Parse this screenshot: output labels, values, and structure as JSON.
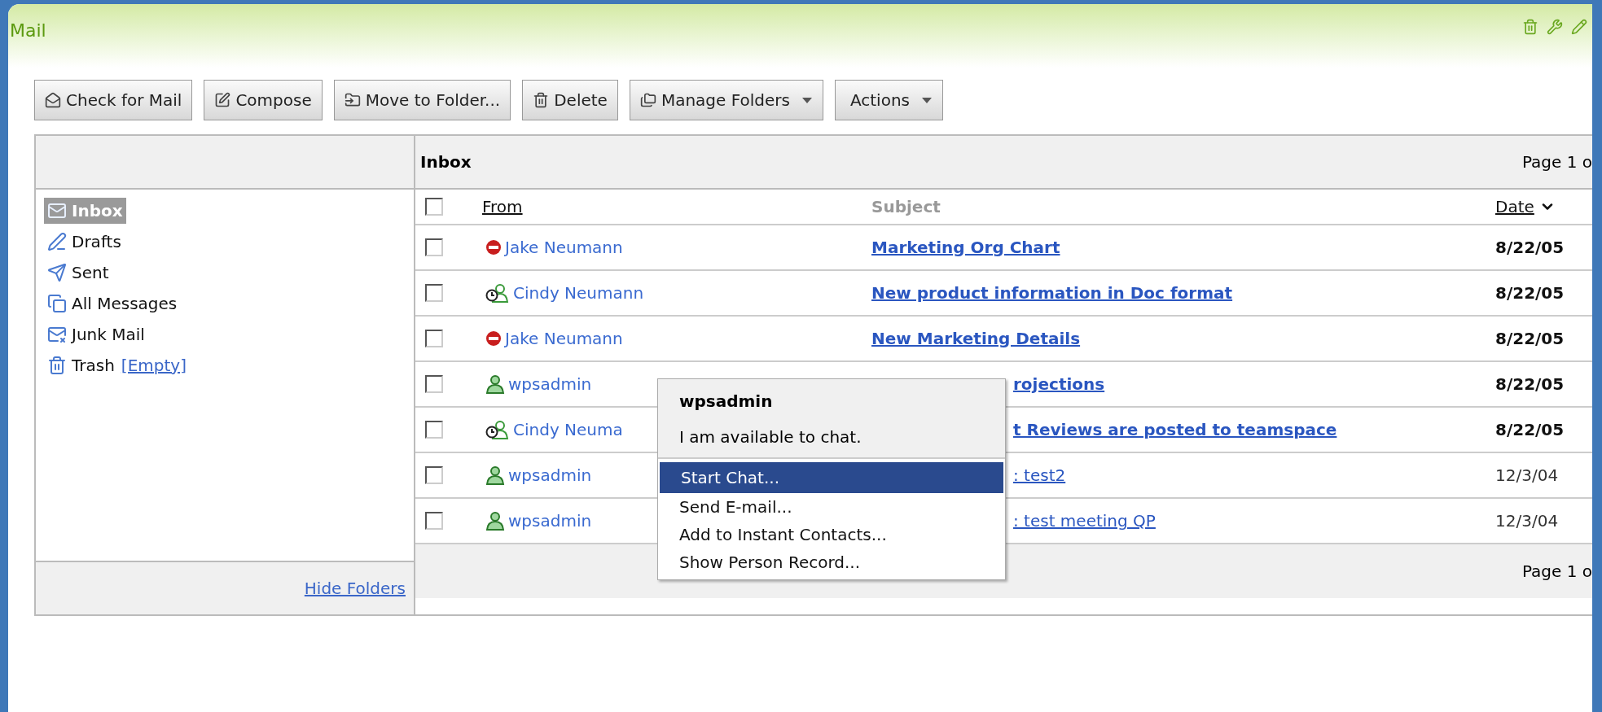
{
  "portlet": {
    "title": "Mail"
  },
  "toolbar": [
    {
      "label": "Check for Mail",
      "dropdown": false
    },
    {
      "label": "Compose",
      "dropdown": false
    },
    {
      "label": "Move to Folder...",
      "dropdown": false
    },
    {
      "label": "Delete",
      "dropdown": false
    },
    {
      "label": "Manage Folders",
      "dropdown": true
    },
    {
      "label": "Actions",
      "dropdown": true
    }
  ],
  "folders": {
    "items": [
      {
        "label": "Inbox",
        "selected": true
      },
      {
        "label": "Drafts",
        "selected": false
      },
      {
        "label": "Sent",
        "selected": false
      },
      {
        "label": "All Messages",
        "selected": false
      },
      {
        "label": "Junk Mail",
        "selected": false
      },
      {
        "label": "Trash",
        "selected": false,
        "link": "[Empty]"
      }
    ],
    "footer_link": "Hide Folders"
  },
  "inbox": {
    "title": "Inbox",
    "page_info": "Page 1 o",
    "select_all_checked": false,
    "columns": [
      {
        "label": "From",
        "sortable": true,
        "sorted": false
      },
      {
        "label": "Subject",
        "sortable": false,
        "sorted": false
      },
      {
        "label": "Date",
        "sortable": true,
        "sorted": true
      }
    ],
    "rows": [
      {
        "checked": false,
        "kind": "busy",
        "from": "Jake Neumann",
        "subject": "Marketing Org Chart",
        "covered": false,
        "date": "8/22/05",
        "unread": true
      },
      {
        "checked": false,
        "kind": "away",
        "from": "Cindy Neumann",
        "subject": "New product information in Doc format",
        "covered": false,
        "date": "8/22/05",
        "unread": true
      },
      {
        "checked": false,
        "kind": "busy",
        "from": "Jake Neumann",
        "subject": "New Marketing Details",
        "covered": false,
        "date": "8/22/05",
        "unread": true
      },
      {
        "checked": false,
        "kind": "available",
        "from": "wpsadmin",
        "subject": "rojections",
        "covered": true,
        "date": "8/22/05",
        "unread": true
      },
      {
        "checked": false,
        "kind": "away",
        "from": "Cindy Neuma",
        "subject": "t Reviews are posted to teamspace",
        "covered": true,
        "date": "8/22/05",
        "unread": true
      },
      {
        "checked": false,
        "kind": "available",
        "from": "wpsadmin",
        "subject": ": test2",
        "covered": true,
        "date": "12/3/04",
        "unread": false
      },
      {
        "checked": false,
        "kind": "available",
        "from": "wpsadmin",
        "subject": ": test meeting QP",
        "covered": true,
        "date": "12/3/04",
        "unread": false
      }
    ],
    "footer_page_info": "Page 1 o"
  },
  "context_menu": {
    "name": "wpsadmin",
    "status": "I am available to chat.",
    "items": [
      {
        "label": "Start Chat...",
        "selected": true
      },
      {
        "label": "Send E-mail...",
        "selected": false
      },
      {
        "label": "Add to Instant Contacts...",
        "selected": false
      },
      {
        "label": "Show Person Record...",
        "selected": false
      }
    ]
  }
}
